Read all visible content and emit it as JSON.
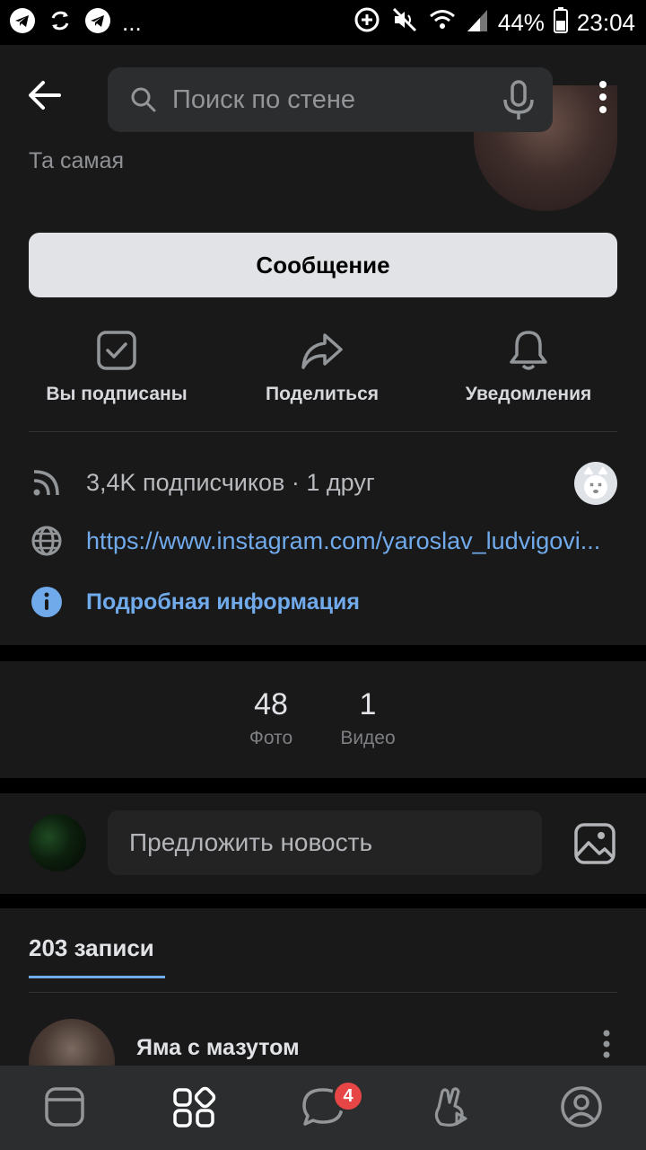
{
  "status_bar": {
    "icons_left": [
      "telegram-icon",
      "sync-icon",
      "telegram-icon"
    ],
    "overflow": "...",
    "icons_right": [
      "data-saver-icon",
      "mute-icon",
      "wifi-icon",
      "signal-icon"
    ],
    "battery": "44%",
    "time": "23:04"
  },
  "header": {
    "search_placeholder": "Поиск по стене"
  },
  "profile": {
    "tagline": "Та самая",
    "message_button": "Сообщение",
    "actions": [
      {
        "label": "Вы подписаны",
        "icon": "check-square-icon"
      },
      {
        "label": "Поделиться",
        "icon": "share-arrow-icon"
      },
      {
        "label": "Уведомления",
        "icon": "bell-icon"
      }
    ],
    "subscribers": "3,4K подписчиков · 1 друг",
    "link": "https://www.instagram.com/yaroslav_ludvigovi...",
    "details": "Подробная информация"
  },
  "media": {
    "photos_count": "48",
    "photos_label": "Фото",
    "videos_count": "1",
    "videos_label": "Видео"
  },
  "suggest": {
    "placeholder": "Предложить новость"
  },
  "posts": {
    "tab_label": "203 записи",
    "first_post_author": "Яма с мазутом"
  },
  "bottom_nav": {
    "items": [
      "feed-icon",
      "services-icon",
      "messages-icon",
      "clips-icon",
      "profile-icon"
    ],
    "messages_badge": "4"
  },
  "colors": {
    "background": "#19191a",
    "accent": "#71aaeb",
    "badge": "#e64646"
  }
}
